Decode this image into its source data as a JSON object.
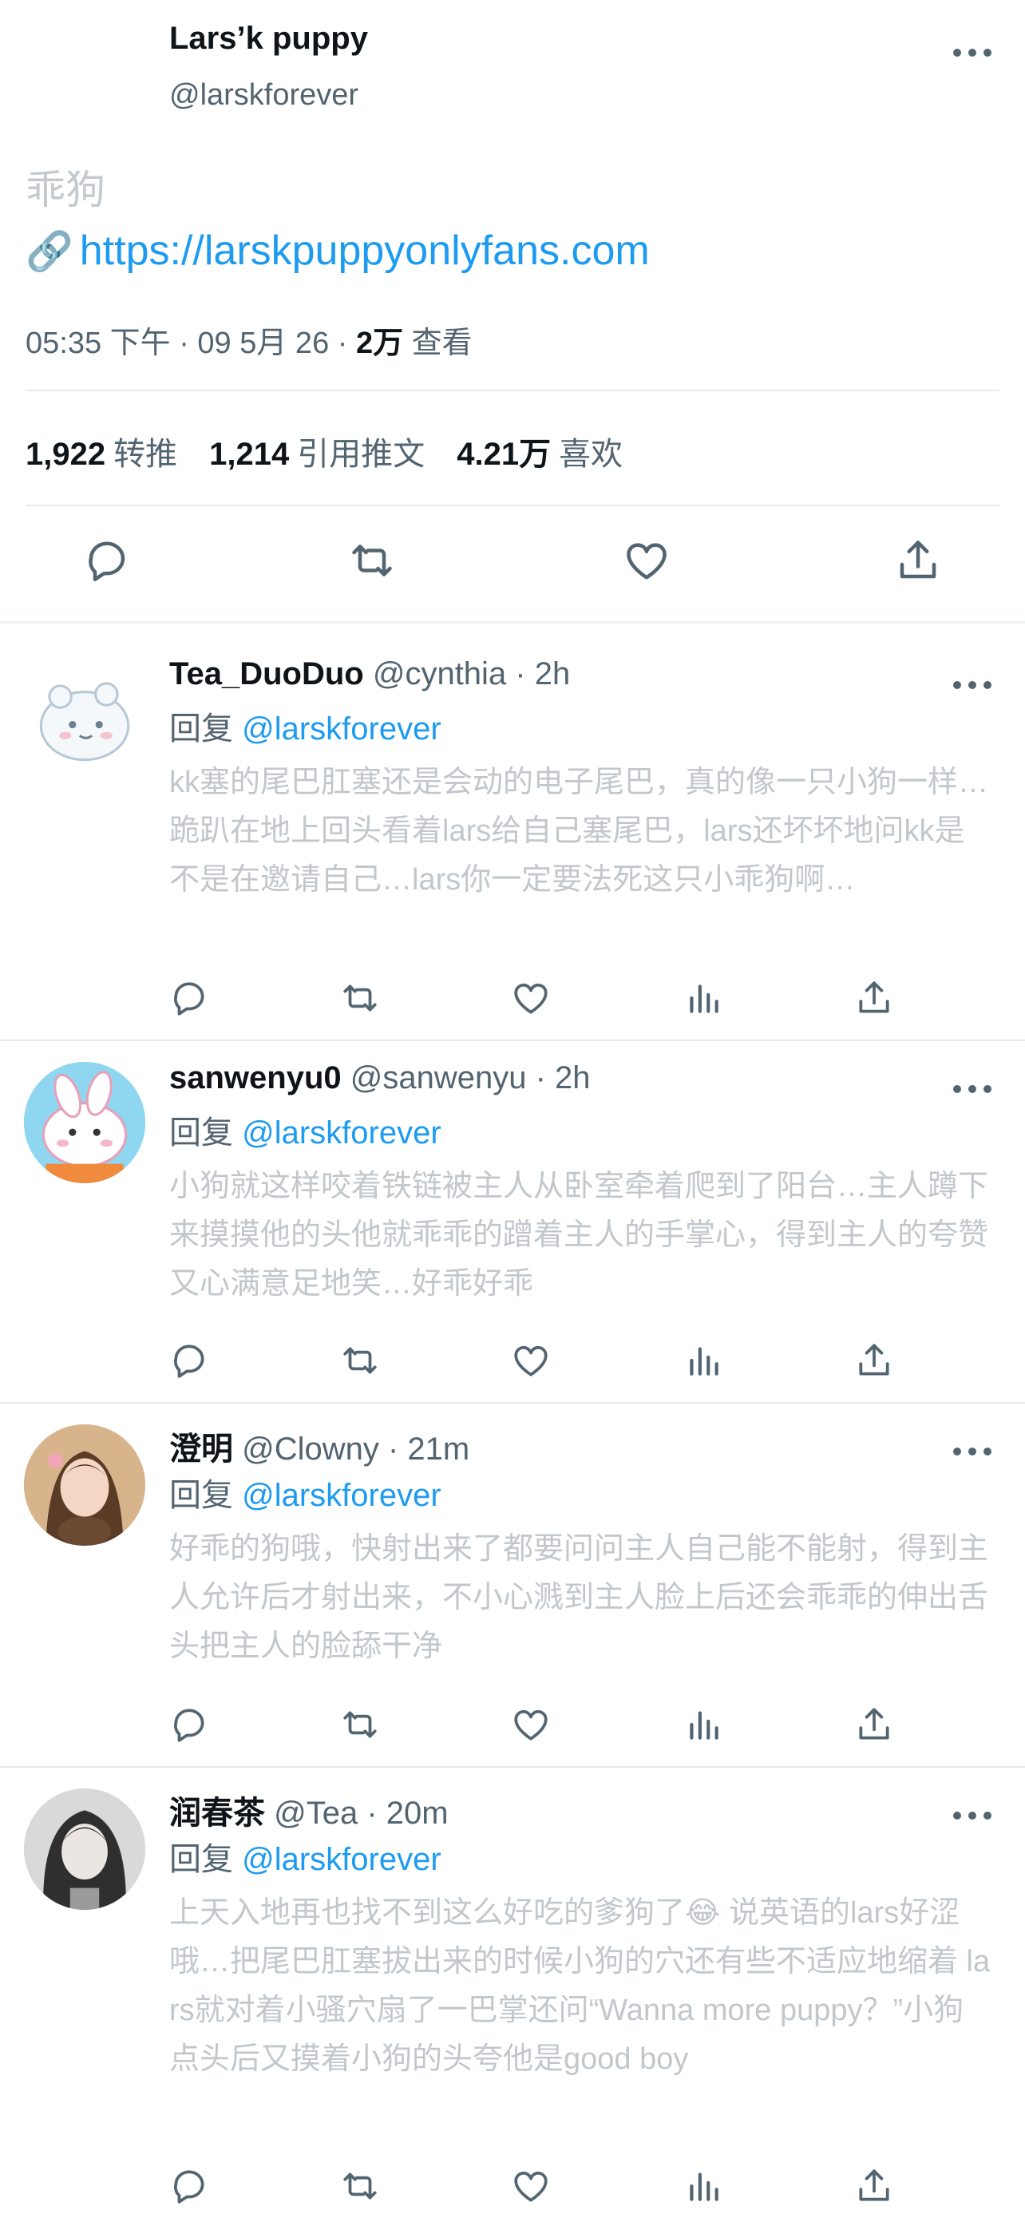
{
  "main_tweet": {
    "author_name": "Lars’k puppy",
    "author_handle": "@larskforever",
    "text": "乖狗",
    "link_icon": "link-icon",
    "link_text": "https://larskpuppyonlyfans.com",
    "time": "05:35 下午 · 09 5月 26 · ",
    "views_count": "2万",
    "views_label": " 查看",
    "retweets_count": "1,922",
    "retweets_label": "转推",
    "quotes_count": "1,214",
    "quotes_label": "引用推文",
    "likes_count": "4.21万",
    "likes_label": "喜欢"
  },
  "replies": [
    {
      "name": "Tea_DuoDuo",
      "handle": "@cynthia · 2h",
      "reply_prefix": "回复 ",
      "reply_to": "@larskforever",
      "text": "kk塞的尾巴肛塞还是会动的电子尾巴，真的像一只小狗一样…跪趴在地上回头看着lars给自己塞尾巴，lars还坏坏地问kk是不是在邀请自己…lars你一定要法死这只小乖狗啊…",
      "avatar": "hamster-cartoon-avatar"
    },
    {
      "name": "sanwenyu0",
      "handle": "@sanwenyu · 2h",
      "reply_prefix": "回复 ",
      "reply_to": "@larskforever",
      "text": "小狗就这样咬着铁链被主人从卧室牵着爬到了阳台…主人蹲下来摸摸他的头他就乖乖的蹭着主人的手掌心，得到主人的夸赞又心满意足地笑…好乖好乖",
      "avatar": "bunny-cartoon-avatar"
    },
    {
      "name": "澄明",
      "handle": "@Clowny · 21m",
      "reply_prefix": "回复 ",
      "reply_to": "@larskforever",
      "text": "好乖的狗哦，快射出来了都要问问主人自己能不能射，得到主人允许后才射出来，不小心溅到主人脸上后还会乖乖的伸出舌头把主人的脸舔干净",
      "avatar": "photo-avatar-girl"
    },
    {
      "name": "润春茶",
      "handle": "@Tea · 20m",
      "reply_prefix": "回复 ",
      "reply_to": "@larskforever",
      "text": "上天入地再也找不到这么好吃的爹狗了😂 说英语的lars好涩哦…把尾巴肛塞拔出来的时候小狗的穴还有些不适应地缩着 lars就对着小骚穴扇了一巴掌还问“Wanna more puppy？”小狗点头后又摸着小狗的头夸他是good boy",
      "avatar": "photo-avatar-girl-2"
    }
  ],
  "colors": {
    "accent": "#1d9bf0",
    "secondary_text": "#536471",
    "faded_text": "#c2c7cc"
  }
}
